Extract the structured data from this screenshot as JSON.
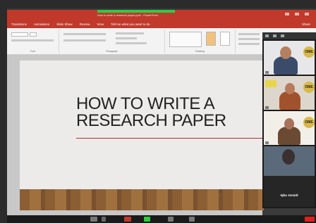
{
  "window": {
    "doc_title": "How to write a research paper.pptx - PowerPoint",
    "tabs": [
      "Transitions",
      "Animations",
      "Slide Show",
      "Review",
      "View",
      "Tell me what you want to do"
    ],
    "share_label": "Share"
  },
  "ribbon": {
    "groups": [
      "Font",
      "Paragraph",
      "Drawing"
    ]
  },
  "slide": {
    "title_line1": "HOW TO WRITE A",
    "title_line2": "RESEARCH PAPER"
  },
  "participants": [
    {
      "badge": "OME"
    },
    {
      "badge": "OME"
    },
    {
      "badge": "OME"
    },
    {
      "name": "Iqba Junaid"
    }
  ],
  "colors": {
    "ribbon_accent": "#c0392b",
    "title_rule": "#b03030",
    "leave_button": "#e02020"
  }
}
